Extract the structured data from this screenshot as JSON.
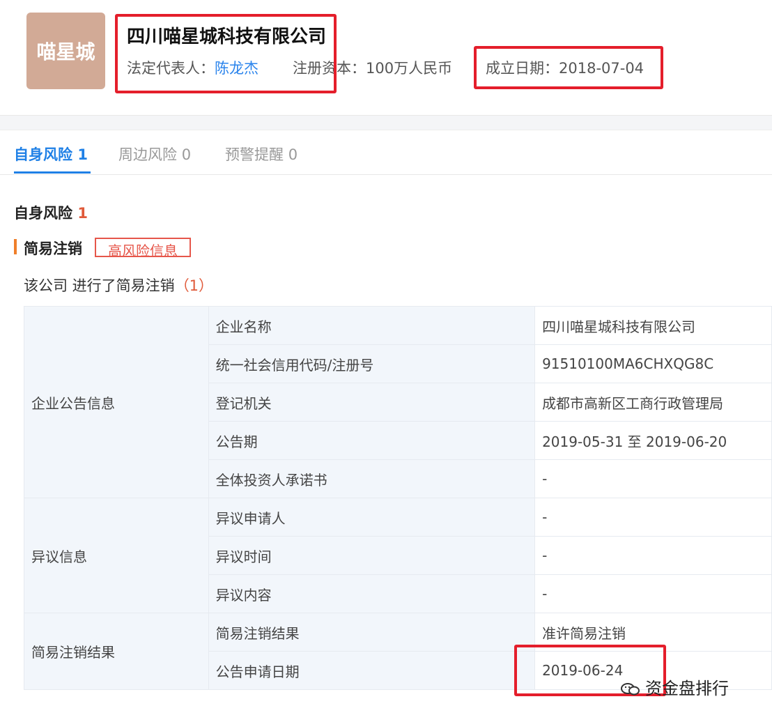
{
  "company": {
    "logo_text": "喵星城",
    "name": "四川喵星城科技有限公司",
    "legal_rep_label": "法定代表人：",
    "legal_rep": "陈龙杰",
    "capital": "注册资本：100万人民币",
    "founded": "成立日期：2018-07-04"
  },
  "tabs": [
    {
      "label": "自身风险",
      "count": "1"
    },
    {
      "label": "周边风险",
      "count": "0"
    },
    {
      "label": "预警提醒",
      "count": "0"
    }
  ],
  "section": {
    "title": "自身风险",
    "count": "1",
    "subtitle": "简易注销",
    "tag": "高风险信息",
    "desc_prefix": "该公司 进行了简易注销",
    "desc_count": "（1）"
  },
  "table": {
    "groups": [
      "企业公告信息",
      "异议信息",
      "简易注销结果"
    ],
    "rows": [
      {
        "label": "企业名称",
        "value": "四川喵星城科技有限公司"
      },
      {
        "label": "统一社会信用代码/注册号",
        "value": "91510100MA6CHXQG8C"
      },
      {
        "label": "登记机关",
        "value": "成都市高新区工商行政管理局"
      },
      {
        "label": "公告期",
        "value": "2019-05-31 至 2019-06-20"
      },
      {
        "label": "全体投资人承诺书",
        "value": "-"
      },
      {
        "label": "异议申请人",
        "value": "-"
      },
      {
        "label": "异议时间",
        "value": "-"
      },
      {
        "label": "异议内容",
        "value": "-"
      },
      {
        "label": "简易注销结果",
        "value": "准许简易注销"
      },
      {
        "label": "公告申请日期",
        "value": "2019-06-24"
      }
    ]
  },
  "watermark": "资金盘排行",
  "colors": {
    "accent": "#1f80e6",
    "highlight": "#e41e2b",
    "logo_bg": "#d2aa96"
  }
}
